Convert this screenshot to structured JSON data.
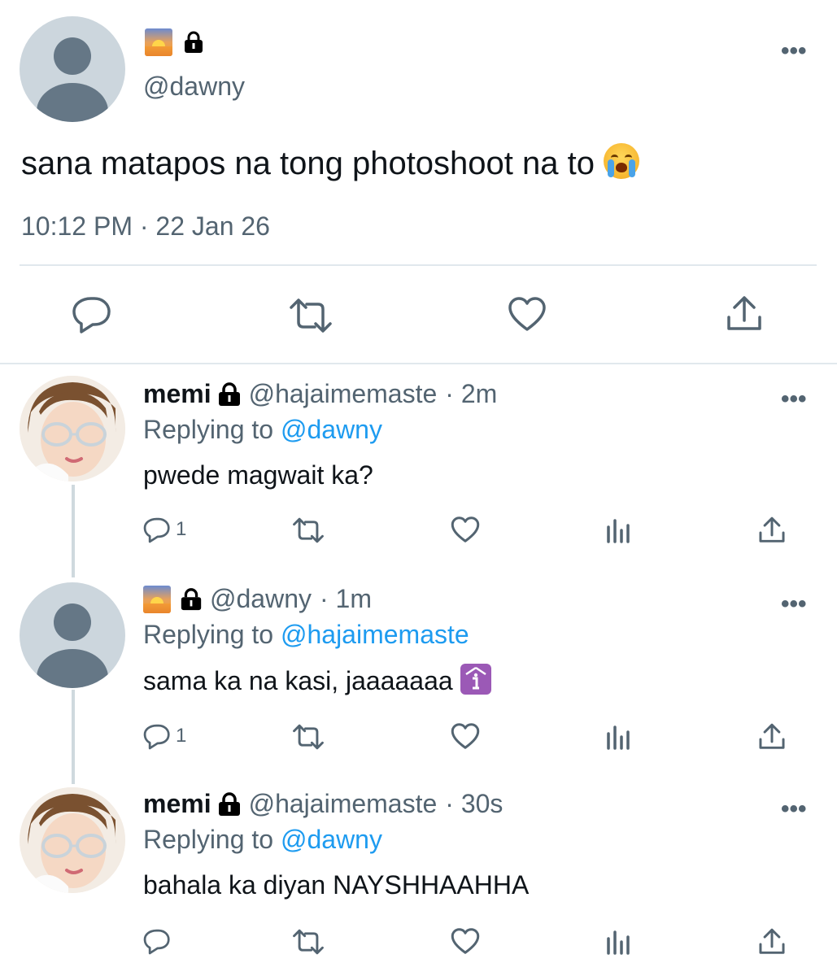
{
  "main_tweet": {
    "display_name_emoji": "sunrise",
    "handle": "@dawny",
    "text": "sana matapos na tong photoshoot na to",
    "text_emoji": "loudly-crying-face",
    "timestamp": "10:12 PM · 22 Jan 26"
  },
  "replies": [
    {
      "name": "memi",
      "handle": "@hajaimemaste",
      "time": "· 2m",
      "replying_label": "Replying to",
      "replying_to": "@dawny",
      "text": "pwede magwait ka?",
      "reply_count": "1"
    },
    {
      "name_emoji": "sunrise",
      "handle": "@dawny",
      "time": "· 1m",
      "replying_label": "Replying to",
      "replying_to": "@hajaimemaste",
      "text": "sama ka na kasi, jaaaaaaa",
      "text_emoji": "information-symbol",
      "reply_count": "1"
    },
    {
      "name": "memi",
      "handle": "@hajaimemaste",
      "time": "· 30s",
      "replying_label": "Replying to",
      "replying_to": "@dawny",
      "text": "bahala ka diyan NAYSHHAAHHA",
      "reply_count": ""
    }
  ],
  "more_glyph": "•••",
  "colors": {
    "link": "#1d9bf0",
    "secondary": "#536471",
    "divider": "#e1e8ed"
  }
}
